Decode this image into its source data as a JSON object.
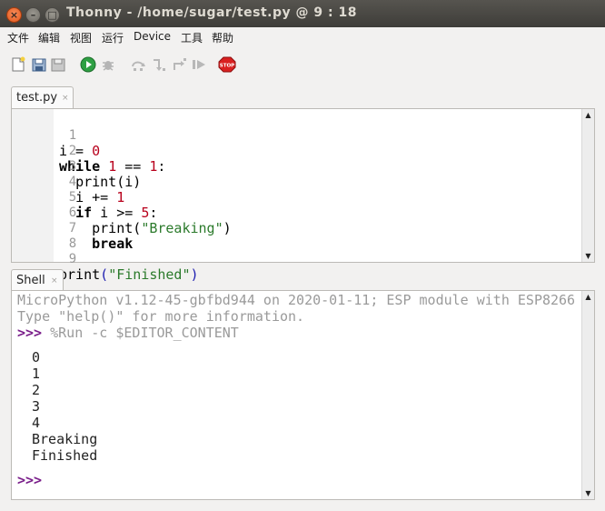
{
  "window": {
    "title": "Thonny  -  /home/sugar/test.py  @  9 : 18",
    "buttons": {
      "close": "×",
      "min": "–",
      "max": "□"
    }
  },
  "menu": [
    "文件",
    "编辑",
    "视图",
    "运行",
    "Device",
    "工具",
    "帮助"
  ],
  "toolbar": {
    "icons": [
      "new-file-icon",
      "open-file-icon",
      "save-file-icon",
      "run-icon",
      "debug-icon",
      "step-over-icon",
      "step-into-icon",
      "step-out-icon",
      "resume-icon",
      "stop-icon"
    ],
    "stop_label": "STOP",
    "colors": {
      "run": "#2ea043",
      "stop": "#d92020"
    }
  },
  "editor_tab": {
    "label": "test.py",
    "close": "×"
  },
  "editor": {
    "line_numbers": [
      "1",
      "2",
      "3",
      "4",
      "5",
      "6",
      "7",
      "8",
      "9"
    ],
    "lines": [
      {
        "indent": "",
        "tokens": [
          {
            "t": "i = ",
            "c": "code"
          },
          {
            "t": "0",
            "c": "num"
          }
        ]
      },
      {
        "indent": "",
        "tokens": [
          {
            "t": "while",
            "c": "kw"
          },
          {
            "t": " ",
            "c": "code"
          },
          {
            "t": "1",
            "c": "num"
          },
          {
            "t": " == ",
            "c": "code"
          },
          {
            "t": "1",
            "c": "num"
          },
          {
            "t": ":",
            "c": "code"
          }
        ]
      },
      {
        "indent": "  ",
        "tokens": [
          {
            "t": "print",
            "c": "code"
          },
          {
            "t": "(i)",
            "c": "code"
          }
        ]
      },
      {
        "indent": "  ",
        "tokens": [
          {
            "t": "i += ",
            "c": "code"
          },
          {
            "t": "1",
            "c": "num"
          }
        ]
      },
      {
        "indent": "  ",
        "tokens": [
          {
            "t": "if",
            "c": "kw"
          },
          {
            "t": " i >= ",
            "c": "code"
          },
          {
            "t": "5",
            "c": "num"
          },
          {
            "t": ":",
            "c": "code"
          }
        ]
      },
      {
        "indent": "    ",
        "tokens": [
          {
            "t": "print",
            "c": "code"
          },
          {
            "t": "(",
            "c": "code"
          },
          {
            "t": "\"Breaking\"",
            "c": "str"
          },
          {
            "t": ")",
            "c": "code"
          }
        ]
      },
      {
        "indent": "    ",
        "tokens": [
          {
            "t": "break",
            "c": "kw"
          }
        ]
      },
      {
        "indent": "",
        "tokens": []
      },
      {
        "indent": "",
        "tokens": [
          {
            "t": "print",
            "c": "code"
          },
          {
            "t": "(",
            "c": "paren"
          },
          {
            "t": "\"Finished\"",
            "c": "str"
          },
          {
            "t": ")",
            "c": "paren"
          }
        ]
      }
    ]
  },
  "shell_tab": {
    "label": "Shell",
    "close": "×"
  },
  "shell": {
    "banner1": "MicroPython v1.12-45-gbfbd944 on 2020-01-11; ESP module with ESP8266",
    "banner2": "Type \"help()\" for more information.",
    "prompt": ">>>",
    "command": " %Run -c $EDITOR_CONTENT",
    "output": [
      "0",
      "1",
      "2",
      "3",
      "4",
      "Breaking",
      "Finished"
    ],
    "final_prompt": ">>>"
  },
  "scroll": {
    "up": "▲",
    "down": "▼"
  }
}
